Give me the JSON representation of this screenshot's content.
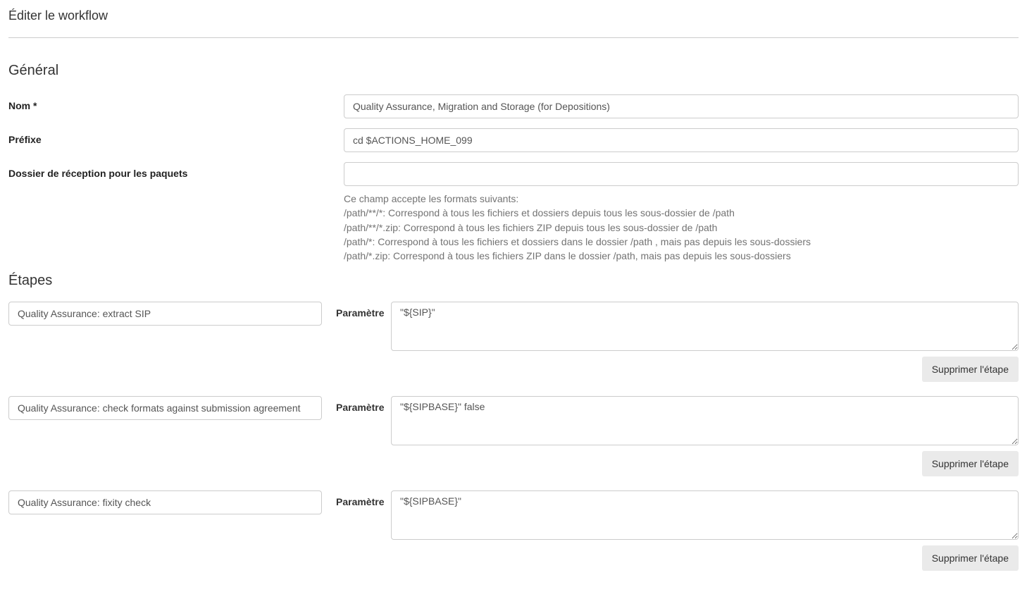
{
  "page_title": "Éditer le workflow",
  "sections": {
    "general": {
      "heading": "Général",
      "fields": {
        "name": {
          "label": "Nom *",
          "value": "Quality Assurance, Migration and Storage (for Depositions)"
        },
        "prefix": {
          "label": "Préfixe",
          "value": "cd $ACTIONS_HOME_099"
        },
        "reception_folder": {
          "label": "Dossier de réception pour les paquets",
          "value": "",
          "help": {
            "intro": "Ce champ accepte les formats suivants:",
            "line1": "/path/**/*: Correspond à tous les fichiers et dossiers depuis tous les sous-dossier de /path",
            "line2": "/path/**/*.zip: Correspond à tous les fichiers ZIP depuis tous les sous-dossier de /path",
            "line3": "/path/*: Correspond à tous les fichiers et dossiers dans le dossier /path , mais pas depuis les sous-dossiers",
            "line4": "/path/*.zip: Correspond à tous les fichiers ZIP dans le dossier /path, mais pas depuis les sous-dossiers"
          }
        }
      }
    },
    "steps": {
      "heading": "Étapes",
      "param_label": "Paramètre",
      "delete_label": "Supprimer l'étape",
      "items": [
        {
          "action": "Quality Assurance: extract SIP",
          "param": "\"${SIP}\""
        },
        {
          "action": "Quality Assurance: check formats against submission agreement",
          "param": "\"${SIPBASE}\" false"
        },
        {
          "action": "Quality Assurance: fixity check",
          "param": "\"${SIPBASE}\""
        }
      ]
    }
  }
}
